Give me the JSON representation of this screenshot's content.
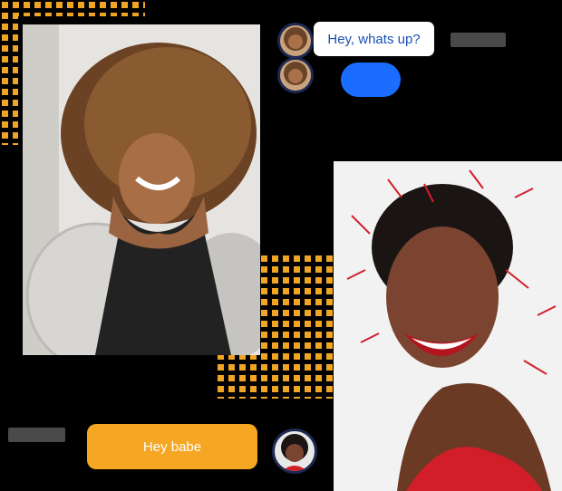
{
  "chat": {
    "incoming_message": "Hey, whats up?",
    "outgoing_message": "Hey babe"
  },
  "colors": {
    "accent_orange": "#f5a623",
    "accent_blue": "#1a6dff",
    "dots_orange": "#f0a524",
    "dark_navy": "#1c2a52"
  },
  "photos": [
    {
      "subject": "woman-curly-hair-smiling-chair"
    },
    {
      "subject": "woman-laughing-red-confetti"
    }
  ]
}
